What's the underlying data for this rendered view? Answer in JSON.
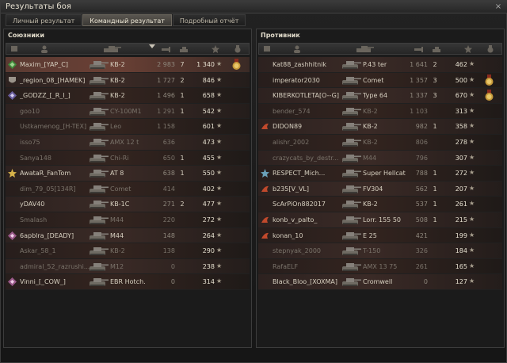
{
  "window": {
    "title": "Результаты боя",
    "close_glyph": "×"
  },
  "tabs": [
    {
      "label": "Личный результат",
      "active": false
    },
    {
      "label": "Командный результат",
      "active": true
    },
    {
      "label": "Подробный отчёт",
      "active": false
    }
  ],
  "allies": {
    "title": "Союзники",
    "rows": [
      {
        "marker": "platoon-green",
        "name": "Maxim_[YAP_C]",
        "tank": "KB-2",
        "dmg": "2 983",
        "kills": "7",
        "xp": "1 340",
        "style": "me",
        "ach": "medal-gold",
        "dead": false
      },
      {
        "marker": "clan-shield",
        "name": "_region_08_[HAMEK]",
        "tank": "KB-2",
        "dmg": "1 727",
        "kills": "2",
        "xp": "846",
        "style": "a",
        "ach": "",
        "dead": false
      },
      {
        "marker": "clan-shield-diamond",
        "name": "_GODZZ_[_R_I_]",
        "tank": "KB-2",
        "dmg": "1 496",
        "kills": "1",
        "xp": "658",
        "style": "b",
        "ach": "",
        "dead": false
      },
      {
        "marker": "",
        "name": "goo10",
        "tank": "CY-100M1",
        "dmg": "1 291",
        "kills": "1",
        "xp": "542",
        "style": "a",
        "ach": "",
        "dead": true
      },
      {
        "marker": "",
        "name": "Ustkamenog_[H-TEX]",
        "tank": "Leo",
        "dmg": "1 158",
        "kills": "",
        "xp": "601",
        "style": "b",
        "ach": "",
        "dead": true
      },
      {
        "marker": "",
        "name": "isso75",
        "tank": "AMX 12 t",
        "dmg": "636",
        "kills": "",
        "xp": "473",
        "style": "a",
        "ach": "",
        "dead": true
      },
      {
        "marker": "",
        "name": "Sanya148",
        "tank": "Chi-Ri",
        "dmg": "650",
        "kills": "1",
        "xp": "455",
        "style": "b",
        "ach": "",
        "dead": true
      },
      {
        "marker": "gold-star",
        "name": "AwataR_FanTom",
        "tank": "AT 8",
        "dmg": "638",
        "kills": "1",
        "xp": "550",
        "style": "a",
        "ach": "",
        "dead": false
      },
      {
        "marker": "",
        "name": "dim_79_05[134R]",
        "tank": "Comet",
        "dmg": "414",
        "kills": "",
        "xp": "402",
        "style": "b",
        "ach": "",
        "dead": true
      },
      {
        "marker": "",
        "name": "yDAV40",
        "tank": "KB-1C",
        "dmg": "271",
        "kills": "2",
        "xp": "477",
        "style": "a",
        "ach": "",
        "dead": false
      },
      {
        "marker": "",
        "name": "Smalash",
        "tank": "M44",
        "dmg": "220",
        "kills": "",
        "xp": "272",
        "style": "b",
        "ach": "",
        "dead": true
      },
      {
        "marker": "clan-diamond",
        "name": "6apblra_[DEADY]",
        "tank": "M44",
        "dmg": "148",
        "kills": "",
        "xp": "264",
        "style": "a",
        "ach": "",
        "dead": false
      },
      {
        "marker": "",
        "name": "Askar_58_1",
        "tank": "KB-2",
        "dmg": "138",
        "kills": "",
        "xp": "290",
        "style": "b",
        "ach": "",
        "dead": true
      },
      {
        "marker": "",
        "name": "admiral_52_razrushi...",
        "tank": "M12",
        "dmg": "0",
        "kills": "",
        "xp": "238",
        "style": "a",
        "ach": "",
        "dead": true
      },
      {
        "marker": "clan-diamond",
        "name": "Vinni_[_COW_]",
        "tank": "EBR Hotch.",
        "dmg": "0",
        "kills": "",
        "xp": "314",
        "style": "b",
        "ach": "",
        "dead": false
      }
    ]
  },
  "enemies": {
    "title": "Противник",
    "rows": [
      {
        "marker": "",
        "name": "Kat88_zashhitnik",
        "tank": "P.43 ter",
        "dmg": "1 641",
        "kills": "2",
        "xp": "462",
        "style": "a",
        "ach": "",
        "dead": false
      },
      {
        "marker": "",
        "name": "imperator2030",
        "tank": "Comet",
        "dmg": "1 357",
        "kills": "3",
        "xp": "500",
        "style": "b",
        "ach": "medal-gold",
        "dead": false
      },
      {
        "marker": "",
        "name": "KIBERKOTLETA[O--G]",
        "tank": "Type 64",
        "dmg": "1 337",
        "kills": "3",
        "xp": "670",
        "style": "a",
        "ach": "medal-gold",
        "dead": false
      },
      {
        "marker": "",
        "name": "bender_574",
        "tank": "KB-2",
        "dmg": "1 103",
        "kills": "",
        "xp": "313",
        "style": "b",
        "ach": "",
        "dead": true
      },
      {
        "marker": "clan-red",
        "name": "DIDON89",
        "tank": "KB-2",
        "dmg": "982",
        "kills": "1",
        "xp": "358",
        "style": "a",
        "ach": "",
        "dead": false
      },
      {
        "marker": "",
        "name": "alishr_2002",
        "tank": "KB-2",
        "dmg": "806",
        "kills": "",
        "xp": "278",
        "style": "b",
        "ach": "",
        "dead": true
      },
      {
        "marker": "",
        "name": "crazycats_by_destr...",
        "tank": "M44",
        "dmg": "796",
        "kills": "",
        "xp": "307",
        "style": "a",
        "ach": "",
        "dead": true
      },
      {
        "marker": "clan-star",
        "name": "RESPECT_Mich...",
        "tank": "Super Hellcat",
        "dmg": "788",
        "kills": "1",
        "xp": "272",
        "style": "b",
        "ach": "",
        "dead": false
      },
      {
        "marker": "clan-red",
        "name": "b235[V_VL]",
        "tank": "FV304",
        "dmg": "562",
        "kills": "1",
        "xp": "207",
        "style": "a",
        "ach": "",
        "dead": false
      },
      {
        "marker": "",
        "name": "ScArPiOn882017",
        "tank": "KB-2",
        "dmg": "537",
        "kills": "1",
        "xp": "261",
        "style": "b",
        "ach": "",
        "dead": false
      },
      {
        "marker": "clan-red",
        "name": "konb_v_palto_",
        "tank": "Lorr. 155 50",
        "dmg": "508",
        "kills": "1",
        "xp": "215",
        "style": "a",
        "ach": "",
        "dead": false
      },
      {
        "marker": "clan-red",
        "name": "konan_10",
        "tank": "E 25",
        "dmg": "421",
        "kills": "",
        "xp": "199",
        "style": "b",
        "ach": "",
        "dead": false
      },
      {
        "marker": "",
        "name": "stepnyak_2000",
        "tank": "T-150",
        "dmg": "326",
        "kills": "",
        "xp": "184",
        "style": "a",
        "ach": "",
        "dead": true
      },
      {
        "marker": "",
        "name": "RafaELF",
        "tank": "AMX 13 75",
        "dmg": "261",
        "kills": "",
        "xp": "165",
        "style": "b",
        "ach": "",
        "dead": true
      },
      {
        "marker": "",
        "name": "Black_Bloo_[XOXMA]",
        "tank": "Cromwell",
        "dmg": "0",
        "kills": "",
        "xp": "127",
        "style": "a",
        "ach": "",
        "dead": false
      }
    ]
  },
  "columns": {
    "icons": [
      "platoon-icon",
      "player-icon",
      "tank-icon",
      "sort-arrow-icon",
      "damage-icon",
      "kills-icon",
      "xp-icon",
      "achievements-icon"
    ]
  }
}
